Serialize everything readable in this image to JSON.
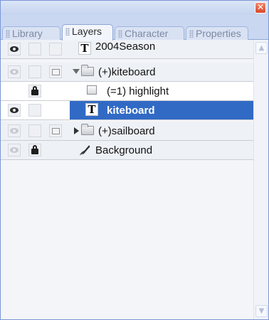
{
  "window": {
    "close_glyph": "✕"
  },
  "tabs": [
    {
      "label": "Library",
      "active": false
    },
    {
      "label": "Layers",
      "active": true
    },
    {
      "label": "Character",
      "active": false
    },
    {
      "label": "Properties",
      "active": false
    }
  ],
  "layers": [
    {
      "name": "2004Season",
      "type": "text",
      "visible": true,
      "locked": false,
      "icon": "text-layer-icon"
    },
    {
      "name": "(+)kiteboard",
      "type": "folder",
      "expanded": true,
      "visible": false,
      "locked": false,
      "icon": "folder-icon"
    },
    {
      "name": "(=1) highlight",
      "type": "bitmap",
      "visible": false,
      "locked": true,
      "icon": "bitmap-layer-icon"
    },
    {
      "name": "kiteboard",
      "type": "text",
      "visible": true,
      "locked": false,
      "selected": true,
      "icon": "text-layer-icon"
    },
    {
      "name": "(+)sailboard",
      "type": "folder",
      "expanded": false,
      "visible": false,
      "locked": false,
      "icon": "folder-icon"
    },
    {
      "name": "Background",
      "type": "brush",
      "visible": false,
      "locked": true,
      "icon": "brush-icon"
    }
  ],
  "glyphs": {
    "text_icon": "T",
    "scroll_up": "▲",
    "scroll_down": "▼"
  },
  "colors": {
    "selection": "#316ac5",
    "panel_bg": "#c9d7f1",
    "close_button": "#d6482a"
  }
}
